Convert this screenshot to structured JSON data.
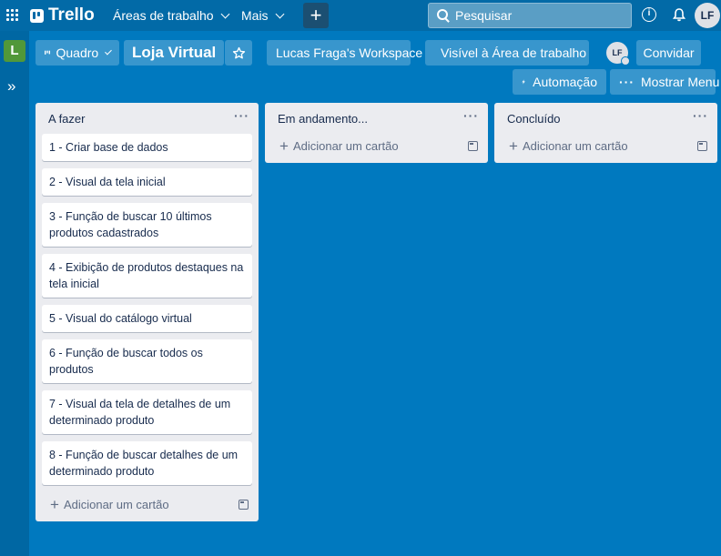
{
  "topbar": {
    "app_name": "Trello",
    "menus": [
      {
        "label": "Áreas de trabalho"
      },
      {
        "label": "Mais"
      }
    ],
    "create_label": "+",
    "search_placeholder": "Pesquisar",
    "info_glyph": "i",
    "user_initials": "LF"
  },
  "sidebar": {
    "workspace_initial": "L",
    "expand_glyph": "»"
  },
  "board_header": {
    "view_label": "Quadro",
    "board_name": "Loja Virtual",
    "workspace_name": "Lucas Fraga's Workspace",
    "visibility_label": "Visível à Área de trabalho",
    "member_initials": "LF",
    "invite_label": "Convidar",
    "automation_label": "Automação",
    "show_menu_label": "Mostrar Menu"
  },
  "lists": [
    {
      "title": "A fazer",
      "cards": [
        "1 - Criar base de dados",
        "2 - Visual da tela inicial",
        "3 - Função de buscar 10 últimos produtos cadastrados",
        "4 - Exibição de produtos destaques na tela inicial",
        "5 - Visual do catálogo virtual",
        "6 - Função de buscar todos os produtos",
        "7 - Visual da tela de detalhes de um determinado produto",
        "8 - Função de buscar detalhes de um determinado produto"
      ],
      "add_card_label": "Adicionar um cartão"
    },
    {
      "title": "Em andamento...",
      "cards": [],
      "add_card_label": "Adicionar um cartão"
    },
    {
      "title": "Concluído",
      "cards": [],
      "add_card_label": "Adicionar um cartão"
    }
  ],
  "colors": {
    "board_background": "#0079bf",
    "topbar": "#026aa7",
    "list_background": "#ebecf0",
    "workspace_badge": "#519839"
  }
}
